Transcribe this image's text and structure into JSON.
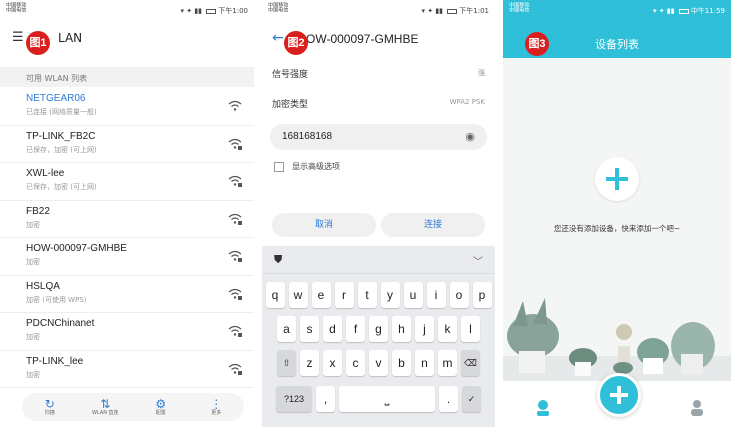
{
  "colors": {
    "accent": "#2e7bd8",
    "teal": "#2fbfd8",
    "badge": "#d9201e"
  },
  "panel1": {
    "badge": "图1",
    "carrier": [
      "中国移动",
      "中国电信"
    ],
    "status_right": "下午1:00",
    "title": "LAN",
    "section_header": "可用 WLAN 列表",
    "networks": [
      {
        "name": "NETGEAR06",
        "status": "已连接 (网络质量一般)"
      },
      {
        "name": "TP-LINK_FB2C",
        "status": "已保存，加密 (可上网)"
      },
      {
        "name": "XWL-lee",
        "status": "已保存，加密 (可上网)"
      },
      {
        "name": "FB22",
        "status": "加密"
      },
      {
        "name": "HOW-000097-GMHBE",
        "status": "加密"
      },
      {
        "name": "HSLQA",
        "status": "加密 (可使用 WPS)"
      },
      {
        "name": "PDCNChinanet",
        "status": "加密"
      },
      {
        "name": "TP-LINK_lee",
        "status": "加密"
      }
    ],
    "toolbar": [
      {
        "label": "扫描",
        "icon": "scan-icon"
      },
      {
        "label": "WLAN 直连",
        "icon": "wifi-direct-icon"
      },
      {
        "label": "配置",
        "icon": "gear-icon"
      },
      {
        "label": "更多",
        "icon": "more-icon"
      }
    ]
  },
  "panel2": {
    "badge": "图2",
    "carrier": [
      "中国移动",
      "中国电信"
    ],
    "status_right": "下午1:01",
    "network_name": "OW-000097-GMHBE",
    "signal_label": "信号强度",
    "signal_value": "强",
    "security_label": "加密类型",
    "security_value": "WPA2 PSK",
    "password": "168168168",
    "advanced_label": "显示高级选项",
    "cancel_label": "取消",
    "connect_label": "连接",
    "keyboard": {
      "row1": [
        "q",
        "w",
        "e",
        "r",
        "t",
        "y",
        "u",
        "i",
        "o",
        "p"
      ],
      "row2": [
        "a",
        "s",
        "d",
        "f",
        "g",
        "h",
        "j",
        "k",
        "l"
      ],
      "row3": [
        "z",
        "x",
        "c",
        "v",
        "b",
        "n",
        "m"
      ],
      "sym": "?123",
      "comma": ",",
      "period": "."
    }
  },
  "panel3": {
    "badge": "图3",
    "carrier": [
      "中国移动",
      "中国电信"
    ],
    "status_right": "中午11:59",
    "title": "设备列表",
    "empty_message": "您还没有添加设备，快来添加一个吧~"
  }
}
